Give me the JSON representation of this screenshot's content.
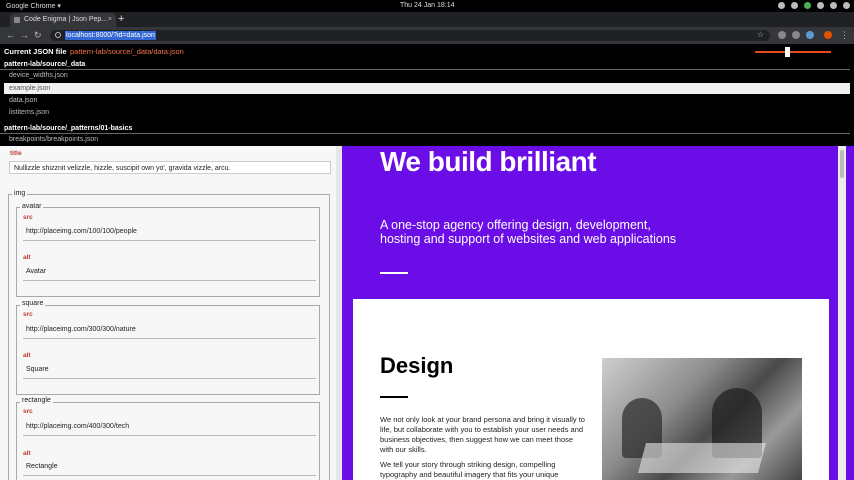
{
  "os": {
    "app_name": "Google Chrome ▾",
    "clock": "Thu 24 Jan  18:14"
  },
  "browser": {
    "tab_title": "Code Enigma | Json Pep...",
    "new_tab": "+",
    "url": "localhost:8000/?id=data.json"
  },
  "json_editor": {
    "current_label": "Current JSON file",
    "current_file": "pattern-lab/source/_data/data.json",
    "dir1": "pattern-lab/source/_data",
    "dir1_files": [
      "device_widths.json",
      "example.json",
      "data.json",
      "listitems.json"
    ],
    "selected_index": 1,
    "dir2": "pattern-lab/source/_patterns/01-basics",
    "dir2_files": [
      "breakpoints/breakpoints.json"
    ]
  },
  "form": {
    "title_label": "title",
    "title_value": "Nullizzle shizznit velizzle, hizzle, suscipit own yo', gravida vizzle, arcu.",
    "img_legend": "img",
    "groups": [
      {
        "legend": "avatar",
        "src_label": "src",
        "src_value": "http://placeimg.com/100/100/people",
        "alt_label": "alt",
        "alt_value": "Avatar"
      },
      {
        "legend": "square",
        "src_label": "src",
        "src_value": "http://placeimg.com/300/300/nature",
        "alt_label": "alt",
        "alt_value": "Square"
      },
      {
        "legend": "rectangle",
        "src_label": "src",
        "src_value": "http://placeimg.com/400/300/tech",
        "alt_label": "alt",
        "alt_value": "Rectangle"
      }
    ]
  },
  "preview": {
    "hero_title": "We build brilliant",
    "hero_sub": "A one-stop agency offering design, development, hosting and support of websites and web applications",
    "card_title": "Design",
    "card_p1": "We not only look at your brand persona and bring it visually to life, but collaborate with you to establish your user needs and business objectives, then suggest how we can meet those with our skills.",
    "card_p2": "We tell your story through striking design, compelling typography and beautiful imagery that fits your unique"
  },
  "colors": {
    "accent": "#6a0de6",
    "slider": "#e64a19",
    "file_highlight": "#f2734b"
  }
}
